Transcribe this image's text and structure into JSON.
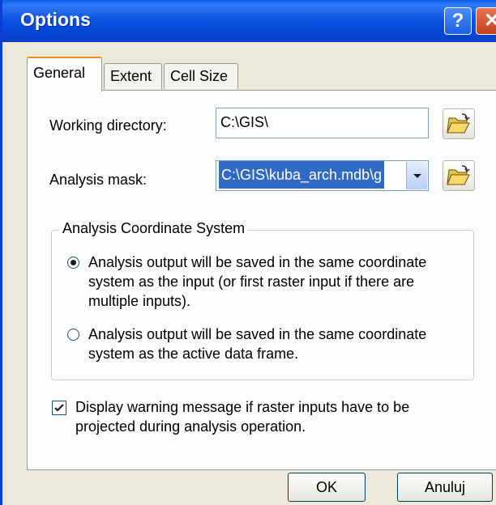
{
  "window": {
    "title": "Options",
    "help_glyph": "?",
    "close_glyph": "✕"
  },
  "tabs": [
    {
      "label": "General",
      "active": true
    },
    {
      "label": "Extent",
      "active": false
    },
    {
      "label": "Cell Size",
      "active": false
    }
  ],
  "general": {
    "working_directory": {
      "label": "Working directory:",
      "value": "C:\\GIS\\"
    },
    "analysis_mask": {
      "label": "Analysis mask:",
      "value": "C:\\GIS\\kuba_arch.mdb\\g"
    },
    "coordinate_group": {
      "title": "Analysis Coordinate System",
      "options": [
        {
          "text": "Analysis output will be saved in the same coordinate system as the input (or first raster input if there are multiple inputs).",
          "selected": true
        },
        {
          "text": "Analysis output will be saved in the same coordinate system as the active data frame.",
          "selected": false
        }
      ]
    },
    "warning_checkbox": {
      "text": "Display warning message if raster inputs have to be projected during analysis operation.",
      "checked": true
    }
  },
  "footer": {
    "ok_label": "OK",
    "cancel_label": "Anuluj"
  }
}
